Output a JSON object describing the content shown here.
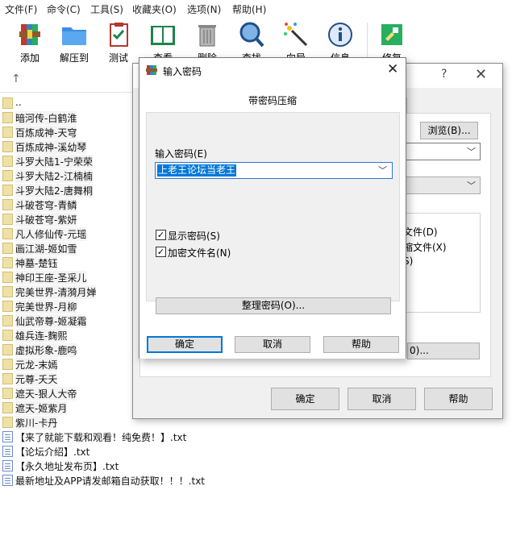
{
  "menu": [
    "文件(F)",
    "命令(C)",
    "工具(S)",
    "收藏夹(O)",
    "选项(N)",
    "帮助(H)"
  ],
  "toolbar": [
    {
      "label": "添加",
      "icon": "archive-add-icon"
    },
    {
      "label": "解压到",
      "icon": "folder-extract-icon"
    },
    {
      "label": "测试",
      "icon": "clipboard-test-icon"
    },
    {
      "label": "查看",
      "icon": "book-view-icon"
    },
    {
      "label": "删除",
      "icon": "trash-icon"
    },
    {
      "label": "查找",
      "icon": "magnifier-icon"
    },
    {
      "label": "向导",
      "icon": "wand-icon"
    },
    {
      "label": "信息",
      "icon": "info-icon"
    },
    {
      "label": "修复",
      "icon": "repair-icon"
    }
  ],
  "files": [
    {
      "name": "..",
      "type": "folder"
    },
    {
      "name": "暗河传-白鹤淮",
      "type": "folder"
    },
    {
      "name": "百炼成神-天穹",
      "type": "folder"
    },
    {
      "name": "百炼成神-溪幼琴",
      "type": "folder"
    },
    {
      "name": "斗罗大陆1-宁荣荣",
      "type": "folder"
    },
    {
      "name": "斗罗大陆2-江楠楠",
      "type": "folder"
    },
    {
      "name": "斗罗大陆2-唐舞桐",
      "type": "folder"
    },
    {
      "name": "斗破苍穹-青鳞",
      "type": "folder"
    },
    {
      "name": "斗破苍穹-紫妍",
      "type": "folder"
    },
    {
      "name": "凡人修仙传-元瑶",
      "type": "folder"
    },
    {
      "name": "画江湖-姬如雪",
      "type": "folder"
    },
    {
      "name": "神墓-楚钰",
      "type": "folder"
    },
    {
      "name": "神印王座-圣采儿",
      "type": "folder"
    },
    {
      "name": "完美世界-清漪月婵",
      "type": "folder"
    },
    {
      "name": "完美世界-月柳",
      "type": "folder"
    },
    {
      "name": "仙武帝尊-姬凝霜",
      "type": "folder"
    },
    {
      "name": "雄兵连-麴熙",
      "type": "folder"
    },
    {
      "name": "虚拟形象-鹿鸣",
      "type": "folder"
    },
    {
      "name": "元龙-末嫣",
      "type": "folder"
    },
    {
      "name": "元尊-夭夭",
      "type": "folder"
    },
    {
      "name": "遮天-狠人大帝",
      "type": "folder"
    },
    {
      "name": "遮天-姬紫月",
      "type": "folder"
    },
    {
      "name": "紫川-卡丹",
      "type": "folder"
    },
    {
      "name": "【来了就能下载和观看！纯免费！】.txt",
      "type": "doc"
    },
    {
      "name": "【论坛介绍】.txt",
      "type": "doc"
    },
    {
      "name": "【永久地址发布页】.txt",
      "type": "doc"
    },
    {
      "name": "最新地址及APP请发邮箱自动获取！！！.txt",
      "type": "doc"
    }
  ],
  "back_dialog": {
    "help_glyph": "?",
    "close_glyph": "✕",
    "browse_label": "浏览(B)...",
    "option1": "文件(D)",
    "option2": "缩文件(X)",
    "option3": "S)",
    "partial_button": "0)...",
    "ok_label": "确定",
    "cancel_label": "取消",
    "help_label": "帮助"
  },
  "password_dialog": {
    "title": "输入密码",
    "close_glyph": "✕",
    "heading": "带密码压缩",
    "field_label": "输入密码(E)",
    "password_value": "上老王论坛当老王",
    "show_password_label": "显示密码(S)",
    "show_password_checked": true,
    "encrypt_names_label": "加密文件名(N)",
    "encrypt_names_checked": true,
    "organize_label": "整理密码(O)...",
    "ok_label": "确定",
    "cancel_label": "取消",
    "help_label": "帮助"
  }
}
